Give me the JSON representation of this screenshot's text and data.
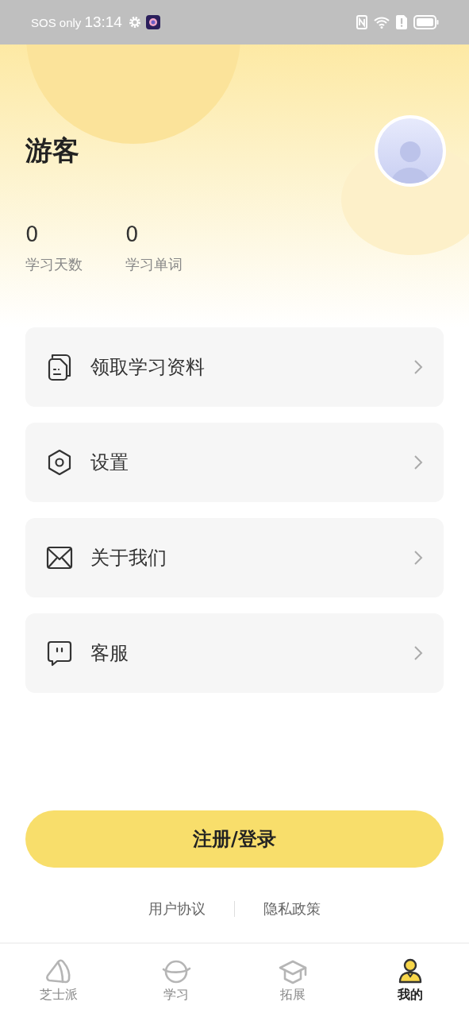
{
  "status_bar": {
    "carrier": "SOS only",
    "time": "13:14"
  },
  "profile": {
    "name": "游客"
  },
  "stats": [
    {
      "value": "0",
      "label": "学习天数"
    },
    {
      "value": "0",
      "label": "学习单词"
    }
  ],
  "menu": [
    {
      "label": "领取学习资料"
    },
    {
      "label": "设置"
    },
    {
      "label": "关于我们"
    },
    {
      "label": "客服"
    }
  ],
  "login_button": "注册/登录",
  "links": [
    "用户协议",
    "隐私政策"
  ],
  "tab_bar": [
    {
      "label": "芝士派",
      "selected": false
    },
    {
      "label": "学习",
      "selected": false
    },
    {
      "label": "拓展",
      "selected": false
    },
    {
      "label": "我的",
      "selected": true
    }
  ]
}
